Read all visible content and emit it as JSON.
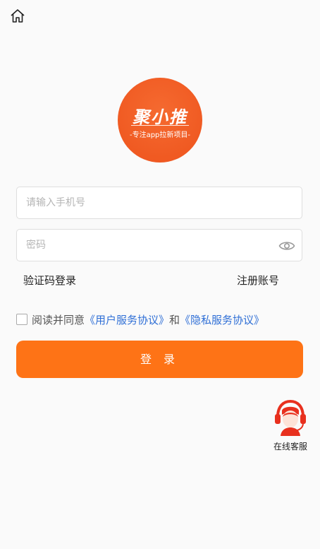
{
  "header": {
    "home_icon": "home-icon"
  },
  "logo": {
    "title": "聚小推",
    "subtitle": "-专注app拉新项目-",
    "color": "#f05a22"
  },
  "form": {
    "phone_placeholder": "请输入手机号",
    "password_placeholder": "密码",
    "eye_icon": "eye-icon"
  },
  "links": {
    "sms_login": "验证码登录",
    "register": "注册账号"
  },
  "agreement": {
    "prefix": "阅读并同意",
    "user_protocol": "《用户服务协议》",
    "conjunction": "和",
    "privacy_protocol": "《隐私服务协议》",
    "link_color": "#2f6fd6"
  },
  "login_button": {
    "label": "登 录",
    "color": "#fe7316"
  },
  "service": {
    "icon": "customer-service-icon",
    "label": "在线客服",
    "color": "#e8301e"
  }
}
